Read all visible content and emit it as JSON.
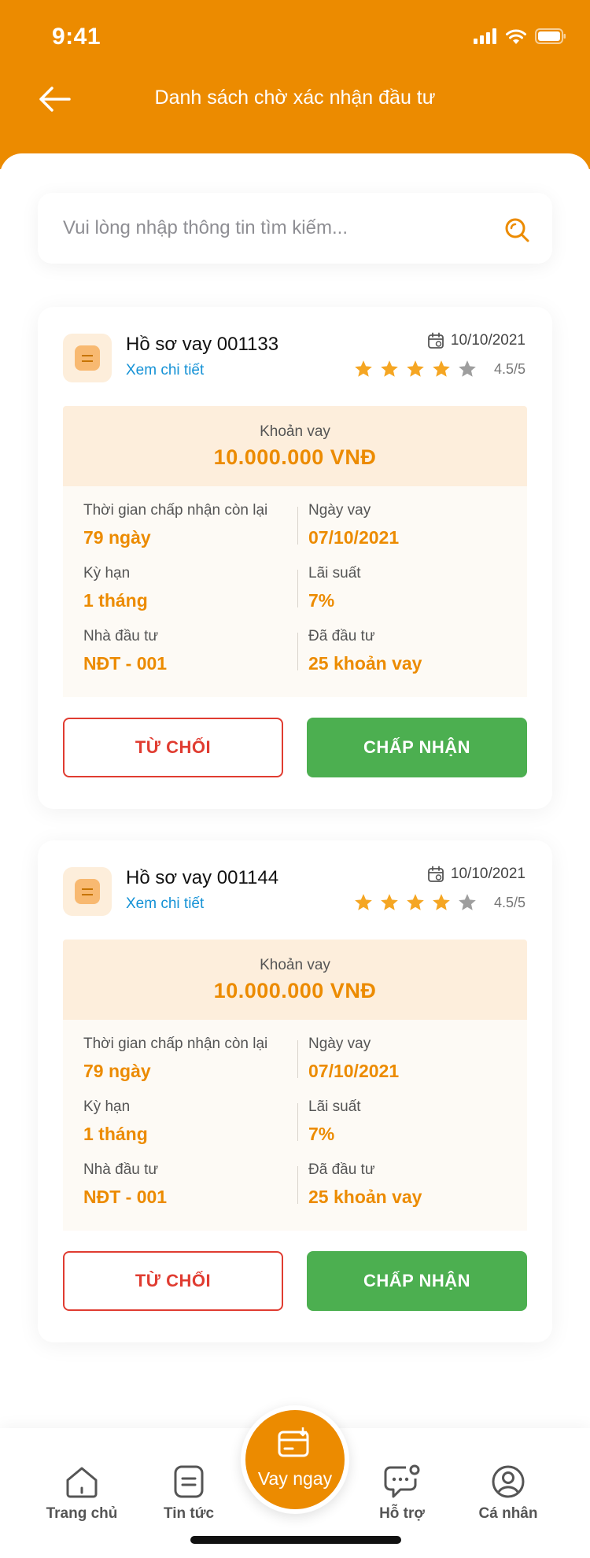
{
  "status_bar": {
    "time": "9:41"
  },
  "header": {
    "title": "Danh sách chờ xác nhận đầu tư"
  },
  "search": {
    "placeholder": "Vui lòng nhập thông tin tìm kiếm..."
  },
  "cards": [
    {
      "title": "Hồ sơ vay 001133",
      "detail_link": "Xem chi tiết",
      "date": "10/10/2021",
      "rating": 4.5,
      "rating_text": "4.5/5",
      "amount_label": "Khoản vay",
      "amount_value": "10.000.000 VNĐ",
      "fields": [
        {
          "label": "Thời gian chấp nhận còn lại",
          "value": "79 ngày"
        },
        {
          "label": "Ngày vay",
          "value": "07/10/2021"
        },
        {
          "label": "Kỳ hạn",
          "value": "1 tháng"
        },
        {
          "label": "Lãi suất",
          "value": "7%"
        },
        {
          "label": "Nhà đầu tư",
          "value": "NĐT - 001"
        },
        {
          "label": "Đã đầu tư",
          "value": "25 khoản vay"
        }
      ],
      "reject_label": "TỪ CHỐI",
      "accept_label": "CHẤP NHẬN"
    },
    {
      "title": "Hồ sơ vay 001144",
      "detail_link": "Xem chi tiết",
      "date": "10/10/2021",
      "rating": 4.5,
      "rating_text": "4.5/5",
      "amount_label": "Khoản vay",
      "amount_value": "10.000.000 VNĐ",
      "fields": [
        {
          "label": "Thời gian chấp nhận còn lại",
          "value": "79 ngày"
        },
        {
          "label": "Ngày vay",
          "value": "07/10/2021"
        },
        {
          "label": "Kỳ hạn",
          "value": "1 tháng"
        },
        {
          "label": "Lãi suất",
          "value": "7%"
        },
        {
          "label": "Nhà đầu tư",
          "value": "NĐT - 001"
        },
        {
          "label": "Đã đầu tư",
          "value": "25 khoản vay"
        }
      ],
      "reject_label": "TỪ CHỐI",
      "accept_label": "CHẤP NHẬN"
    }
  ],
  "bottom_nav": {
    "items": [
      {
        "label": "Trang chủ",
        "icon": "home-icon"
      },
      {
        "label": "Tin tức",
        "icon": "news-icon"
      },
      {
        "label": "Hỗ trợ",
        "icon": "support-chat-icon"
      },
      {
        "label": "Cá nhân",
        "icon": "profile-icon"
      }
    ],
    "fab_label": "Vay ngay",
    "fab_icon": "loan-card-icon"
  },
  "colors": {
    "brand": "#EC8B00",
    "accept": "#4CAF50",
    "reject": "#E03C31",
    "link": "#1592D6",
    "star_filled": "#F5A623",
    "star_empty": "#9E9E9E"
  }
}
